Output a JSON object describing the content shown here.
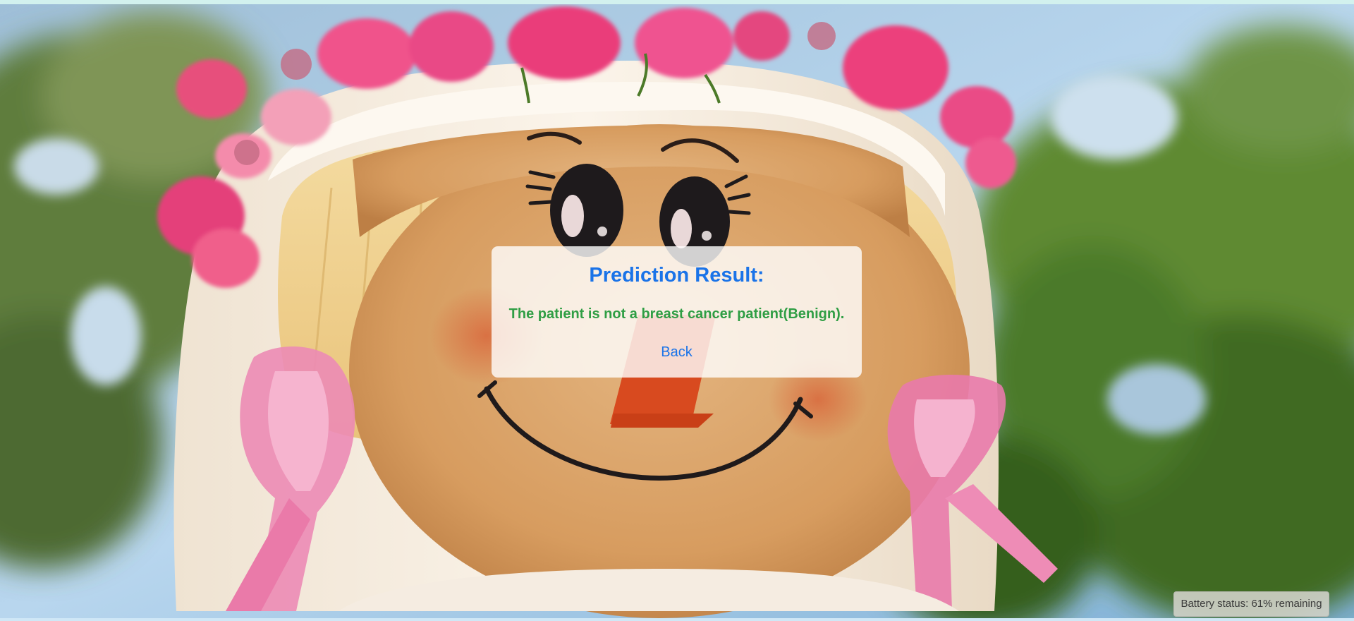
{
  "result": {
    "title": "Prediction Result:",
    "message": "The patient is not a breast cancer patient(Benign).",
    "back_label": "Back"
  },
  "status": {
    "battery_text": "Battery status: 61% remaining"
  },
  "background": {
    "description_icon": "scarecrow-doll-photo"
  },
  "colors": {
    "title": "#1a73e8",
    "message": "#2f9e44",
    "link": "#1a73e8"
  }
}
